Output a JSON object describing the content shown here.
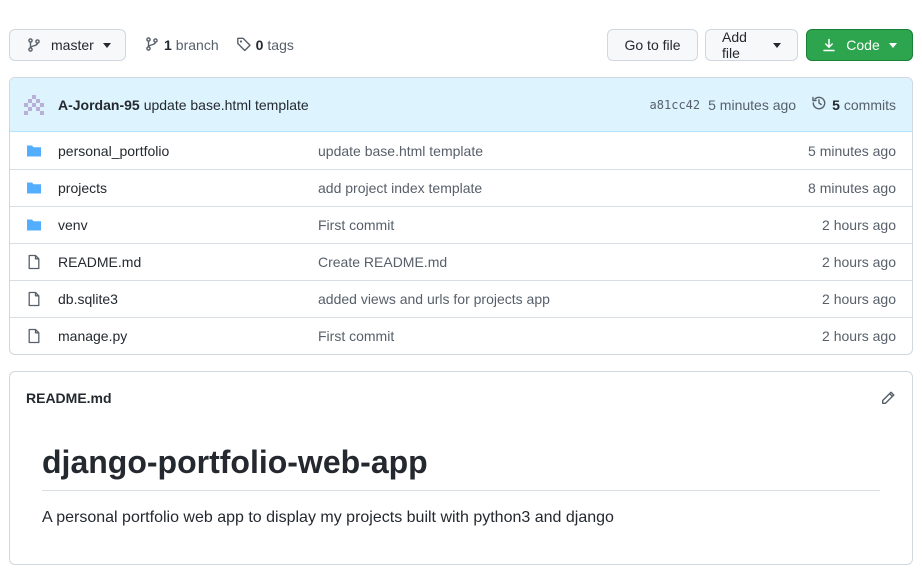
{
  "toolbar": {
    "branch_name": "master",
    "branch_count": "1",
    "branch_label": "branch",
    "tag_count": "0",
    "tag_label": "tags",
    "goto_label": "Go to file",
    "add_label": "Add file",
    "code_label": "Code"
  },
  "latest_commit": {
    "author": "A-Jordan-95",
    "message": "update base.html template",
    "sha": "a81cc42",
    "time": "5 minutes ago",
    "commit_count": "5",
    "commit_label": "commits"
  },
  "files": [
    {
      "name": "personal_portfolio",
      "type": "folder",
      "message": "update base.html template",
      "time": "5 minutes ago"
    },
    {
      "name": "projects",
      "type": "folder",
      "message": "add project index template",
      "time": "8 minutes ago"
    },
    {
      "name": "venv",
      "type": "folder",
      "message": "First commit",
      "time": "2 hours ago"
    },
    {
      "name": "README.md",
      "type": "file",
      "message": "Create README.md",
      "time": "2 hours ago"
    },
    {
      "name": "db.sqlite3",
      "type": "file",
      "message": "added views and urls for projects app",
      "time": "2 hours ago"
    },
    {
      "name": "manage.py",
      "type": "file",
      "message": "First commit",
      "time": "2 hours ago"
    }
  ],
  "readme": {
    "filename": "README.md",
    "heading": "django-portfolio-web-app",
    "body": "A personal portfolio web app to display my projects built with python3 and django"
  },
  "colors": {
    "folder": "#54aeff",
    "file": "#57606a",
    "code_button": "#2da44e",
    "commit_bar": "#ddf4ff"
  },
  "icons": {
    "branch": "git-branch-icon",
    "tag": "tag-icon",
    "history": "history-icon",
    "download": "download-icon",
    "folder": "folder-icon",
    "file": "file-icon",
    "pencil": "pencil-icon"
  }
}
